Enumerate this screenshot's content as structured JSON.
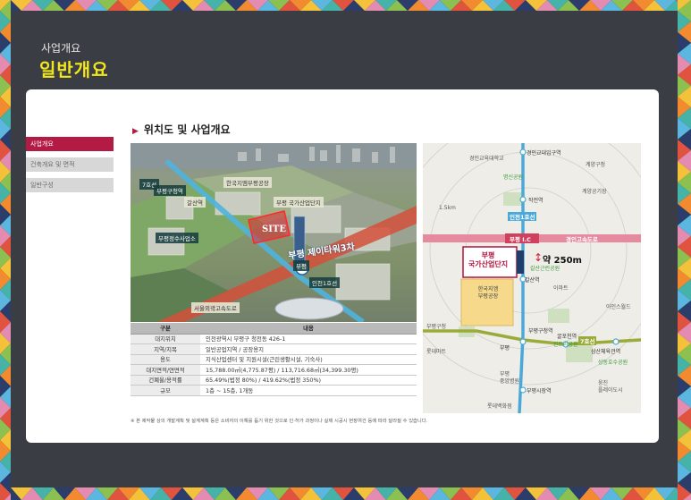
{
  "header": {
    "subtitle": "사업개요",
    "title": "일반개요"
  },
  "side_menu": {
    "items": [
      "사업개요",
      "건축개요 및 면적",
      "일반구성"
    ],
    "active_index": 0
  },
  "section": {
    "title": "위치도 및 사업개요"
  },
  "photo_labels": {
    "line7": "7호선",
    "station": "부평구청역",
    "factory": "한국지엠부평공장",
    "industrial": "부평\n국가산업단지",
    "water": "부평정수사업소",
    "gasan": "갈산역",
    "site": "SITE",
    "tower": "부평 제이타워3차",
    "bupyeong": "부평",
    "line1": "인천1호선",
    "expressway": "서울외곽고속도로"
  },
  "table": {
    "headers": [
      "구분",
      "내용"
    ],
    "rows": [
      [
        "대지위치",
        "인천광역시 부평구 청천동 426-1"
      ],
      [
        "지역/지목",
        "일반공업지역 / 공장용지"
      ],
      [
        "용도",
        "지식산업센터 및 지원시설(근린생활시설, 기숙사)"
      ],
      [
        "대지면적/연면적",
        "15,788.00㎡(4,775.87평) / 113,716.68㎡(34,399.30평)"
      ],
      [
        "건폐율/용적률",
        "65.49%(법정 80%) / 419.62%(법정 350%)"
      ],
      [
        "규모",
        "1층 ~ 15층, 1개동"
      ]
    ],
    "footnote": "※ 본 제작물 상의 개발계획 및 설계계획 등은 소비자의 이해를 돕기 위한 것으로 인·허가 과정이나 실제 시공시 현장여건 등에 따라 달라질 수 있습니다."
  },
  "map": {
    "labels": {
      "gyeongin_univ": "경인교대입구역",
      "gyeongin_edu": "경인교육대학교",
      "gyeyang": "계양구청",
      "sinwon": "명신공원",
      "jakjeon": "작전역",
      "gyeyang_factory": "계양공기장",
      "line1_station": "인천1호선",
      "bupyeong_ic": "부평 I.C",
      "expressway": "경인고속도로",
      "distance": "약 250m",
      "gasan_park": "갈산근린공원",
      "complex": "부평\n국가산업단지",
      "gasan": "갈산역",
      "emart": "이마트",
      "gm": "한국지엠\n부평공장",
      "apartments": "아인스월드",
      "bupyeong_gucheong": "부평구청역",
      "gulpo": "굴포천역",
      "cheonggye": "부평구청",
      "line7": "7호선",
      "jinseon_park": "진트리공원",
      "lottemart": "롯데마트",
      "samsan": "삼산체육관역",
      "samsan_sports": "삼산월드체육관",
      "sangdong_park": "상동호수공원",
      "bupyeong_market_station": "부평시장역",
      "bupyeong_central": "부평\n중앙병원",
      "lotte_dept": "롯데백화점",
      "hospital": "부평",
      "ungjin": "웅진\n플레이도시",
      "scale": "1.5km"
    }
  }
}
